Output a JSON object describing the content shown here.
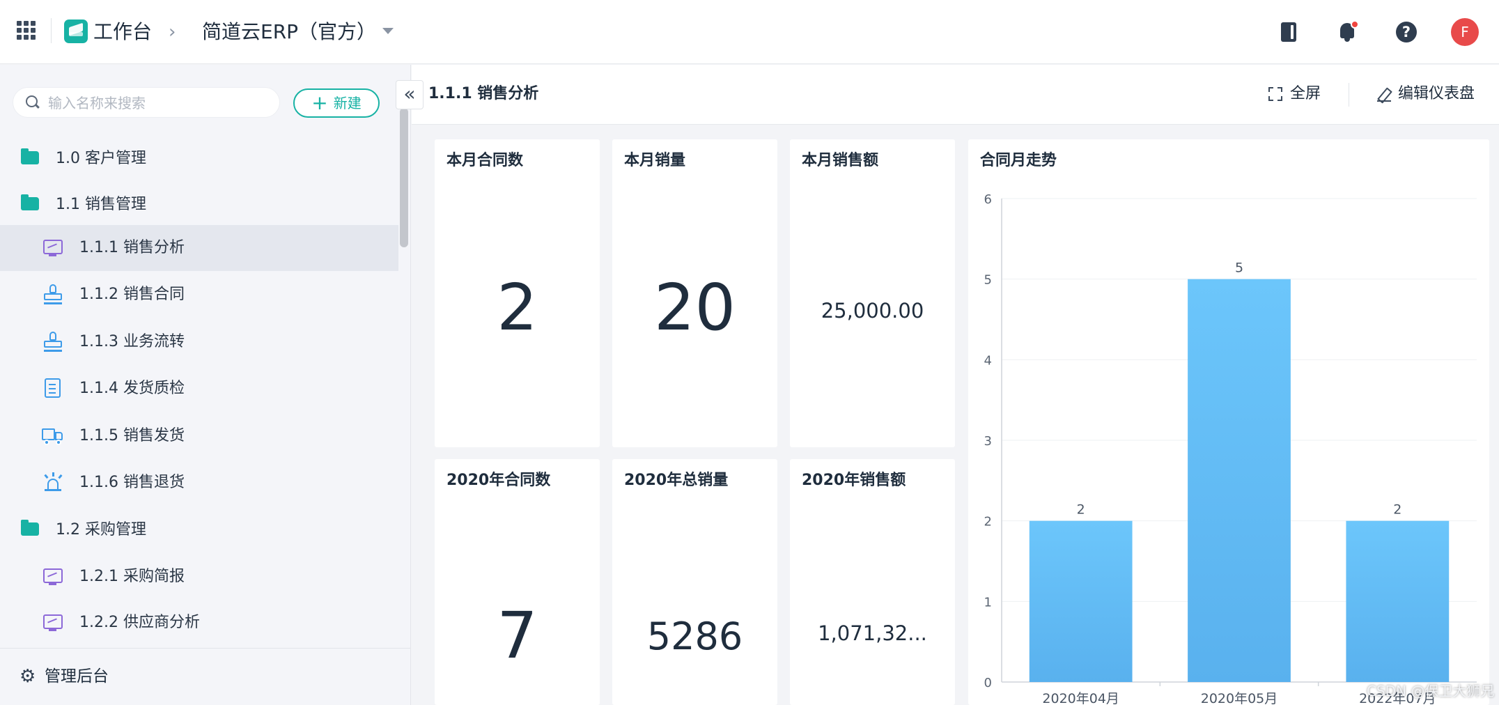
{
  "topbar": {
    "workspace_title": "工作台",
    "crumb_separator": "›",
    "app_title": "简道云ERP（官方）",
    "avatar_letter": "F",
    "help_glyph": "?"
  },
  "sidebar": {
    "search_placeholder": "输入名称来搜索",
    "new_button_label": "新建",
    "new_button_plus": "+",
    "collapse_glyph": "«",
    "items": [
      {
        "label": "1.0 客户管理",
        "icon": "folder-icon"
      },
      {
        "label": "1.1 销售管理",
        "icon": "folder-icon"
      },
      {
        "label": "1.1.1 销售分析",
        "icon": "dashboard-monitor-icon",
        "active": true
      },
      {
        "label": "1.1.2 销售合同",
        "icon": "stamp-icon"
      },
      {
        "label": "1.1.3 业务流转",
        "icon": "stamp-icon"
      },
      {
        "label": "1.1.4 发货质检",
        "icon": "document-icon"
      },
      {
        "label": "1.1.5 销售发货",
        "icon": "truck-icon"
      },
      {
        "label": "1.1.6 销售退货",
        "icon": "alarm-icon"
      },
      {
        "label": "1.2 采购管理",
        "icon": "folder-icon"
      },
      {
        "label": "1.2.1 采购简报",
        "icon": "dashboard-monitor-icon"
      },
      {
        "label": "1.2.2 供应商分析",
        "icon": "dashboard-monitor-icon"
      }
    ],
    "admin_label": "管理后台",
    "admin_glyph": "⚙"
  },
  "main": {
    "page_title": "1.1.1 销售分析",
    "fullscreen_label": "全屏",
    "edit_label": "编辑仪表盘",
    "cards": [
      {
        "title": "本月合同数",
        "value": "2"
      },
      {
        "title": "本月销量",
        "value": "20"
      },
      {
        "title": "本月销售额",
        "value": "25,000.00"
      },
      {
        "title": "2020年合同数",
        "value": "7"
      },
      {
        "title": "2020年总销量",
        "value": "5286"
      },
      {
        "title": "2020年销售额",
        "value": "1,071,32..."
      }
    ]
  },
  "chart_data": {
    "type": "bar",
    "title": "合同月走势",
    "categories": [
      "2020年04月",
      "2020年05月",
      "2022年07月"
    ],
    "values": [
      2,
      5,
      2
    ],
    "ylim": [
      0,
      6
    ],
    "yticks": [
      "0",
      "1",
      "2",
      "3",
      "4",
      "5",
      "6"
    ],
    "data_labels": [
      "2",
      "5",
      "2"
    ],
    "grid": true,
    "bar_color": "#62bdf6"
  },
  "watermark": "CSDN @保卫大狮兄",
  "colors": {
    "accent": "#17b2a4",
    "avatar": "#e84a4a",
    "notification_dot": "#f0443e"
  }
}
